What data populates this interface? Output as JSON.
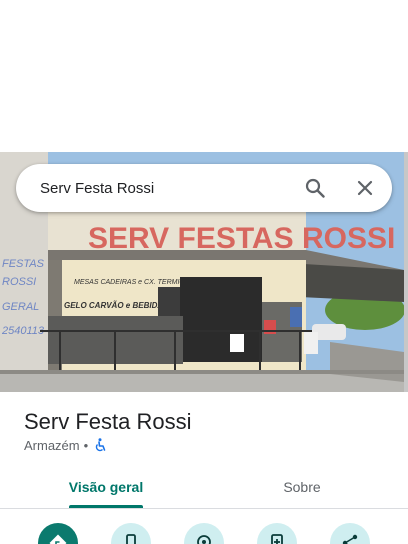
{
  "search": {
    "query": "Serv Festa Rossi"
  },
  "photo": {
    "store_sign": "SERV FESTAS ROSSI",
    "wall_text_1": "MESAS CADEIRAS e CX. TERMICAS",
    "wall_text_2": "GELO CARVÃO e BEBIDAS",
    "side_wall_1": "FESTAS",
    "side_wall_2": "ROSSI",
    "side_wall_3": "GERAL",
    "side_wall_4": "2540113"
  },
  "place": {
    "name": "Serv Festa Rossi",
    "category": "Armazém",
    "separator": "•"
  },
  "tabs": [
    {
      "label": "Visão geral",
      "selected": true
    },
    {
      "label": "Sobre",
      "selected": false
    }
  ],
  "colors": {
    "accent": "#00776a",
    "action_bg": "#cfeef0",
    "primary_action_bg": "#0b7a6e"
  },
  "actions": [
    {
      "icon": "directions-icon"
    },
    {
      "icon": "phone-icon"
    },
    {
      "icon": "location-pin-icon"
    },
    {
      "icon": "save-icon"
    },
    {
      "icon": "share-icon"
    }
  ]
}
